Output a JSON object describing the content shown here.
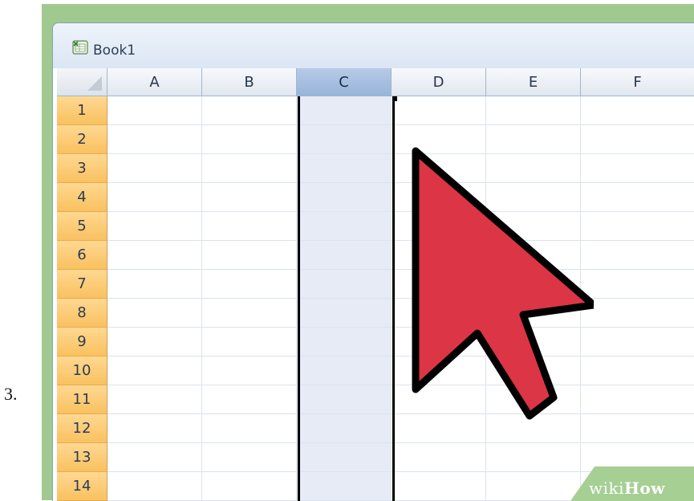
{
  "step": {
    "number": "3."
  },
  "window": {
    "title": "Book1",
    "icon": "excel-workbook-icon"
  },
  "columns": [
    {
      "label": "A",
      "selected": false
    },
    {
      "label": "B",
      "selected": false
    },
    {
      "label": "C",
      "selected": true
    },
    {
      "label": "D",
      "selected": false
    },
    {
      "label": "E",
      "selected": false
    },
    {
      "label": "F",
      "selected": false
    }
  ],
  "rows": [
    "1",
    "2",
    "3",
    "4",
    "5",
    "6",
    "7",
    "8",
    "9",
    "10",
    "11",
    "12",
    "13",
    "14"
  ],
  "cursor": {
    "icon": "mouse-pointer-arrow-icon",
    "color": "#dc3545"
  },
  "watermark": {
    "part1": "wiki",
    "part2": "How"
  },
  "colors": {
    "frame": "#9fc98e",
    "selected_column_header": "#97b4da",
    "row_header": "#f9c160",
    "selected_cells": "#e7ebf5"
  }
}
